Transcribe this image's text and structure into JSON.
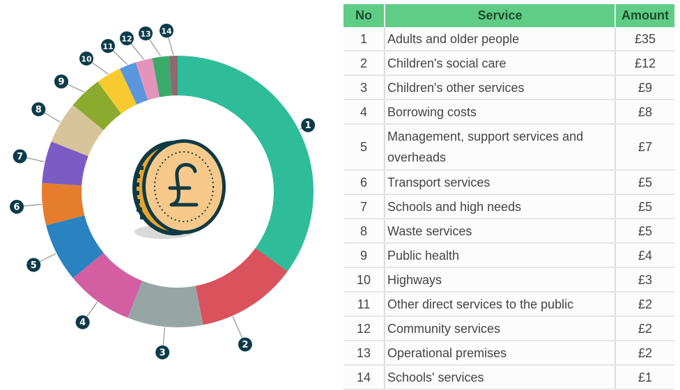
{
  "chart_data": {
    "type": "pie",
    "variant": "donut",
    "title": "",
    "start": "top, clockwise",
    "center_icon": "pound-coin-icon",
    "slices": [
      {
        "no": 1,
        "label": "Adults and older people",
        "value": 35,
        "color": "#2ebd98"
      },
      {
        "no": 2,
        "label": "Children's social care",
        "value": 12,
        "color": "#d9525c"
      },
      {
        "no": 3,
        "label": "Children's other services",
        "value": 9,
        "color": "#98a5a5"
      },
      {
        "no": 4,
        "label": "Borrowing costs",
        "value": 8,
        "color": "#d35fa2"
      },
      {
        "no": 5,
        "label": "Management, support services and overheads",
        "value": 7,
        "color": "#2a82c0"
      },
      {
        "no": 6,
        "label": "Transport services",
        "value": 5,
        "color": "#e57d2c"
      },
      {
        "no": 7,
        "label": "Schools and high needs",
        "value": 5,
        "color": "#7b5bc4"
      },
      {
        "no": 8,
        "label": "Waste services",
        "value": 5,
        "color": "#d8c49a"
      },
      {
        "no": 9,
        "label": "Public health",
        "value": 4,
        "color": "#8cab2e"
      },
      {
        "no": 10,
        "label": "Highways",
        "value": 3,
        "color": "#f7cb2f"
      },
      {
        "no": 11,
        "label": "Other direct services to the public",
        "value": 2,
        "color": "#5b96dd"
      },
      {
        "no": 12,
        "label": "Community services",
        "value": 2,
        "color": "#e494bb"
      },
      {
        "no": 13,
        "label": "Operational premises",
        "value": 2,
        "color": "#3aaa6b"
      },
      {
        "no": 14,
        "label": "Schools' services",
        "value": 1,
        "color": "#8a6b6e"
      }
    ],
    "badge_color": "#0d3b4a"
  },
  "table": {
    "headers": {
      "no": "No",
      "service": "Service",
      "amount": "Amount"
    },
    "header_color": "#5fcd86",
    "rows": [
      {
        "no": "1",
        "service": "Adults and older people",
        "amount": "£35"
      },
      {
        "no": "2",
        "service": "Children's social care",
        "amount": "£12"
      },
      {
        "no": "3",
        "service": "Children's other services",
        "amount": "£9"
      },
      {
        "no": "4",
        "service": "Borrowing costs",
        "amount": "£8"
      },
      {
        "no": "5",
        "service": "Management, support services and overheads",
        "amount": "£7"
      },
      {
        "no": "6",
        "service": "Transport services",
        "amount": "£5"
      },
      {
        "no": "7",
        "service": "Schools and high needs",
        "amount": "£5"
      },
      {
        "no": "8",
        "service": "Waste services",
        "amount": "£5"
      },
      {
        "no": "9",
        "service": "Public health",
        "amount": "£4"
      },
      {
        "no": "10",
        "service": "Highways",
        "amount": "£3"
      },
      {
        "no": "11",
        "service": "Other direct services to the public",
        "amount": "£2"
      },
      {
        "no": "12",
        "service": "Community services",
        "amount": "£2"
      },
      {
        "no": "13",
        "service": "Operational premises",
        "amount": "£2"
      },
      {
        "no": "14",
        "service": "Schools' services",
        "amount": "£1"
      }
    ]
  }
}
